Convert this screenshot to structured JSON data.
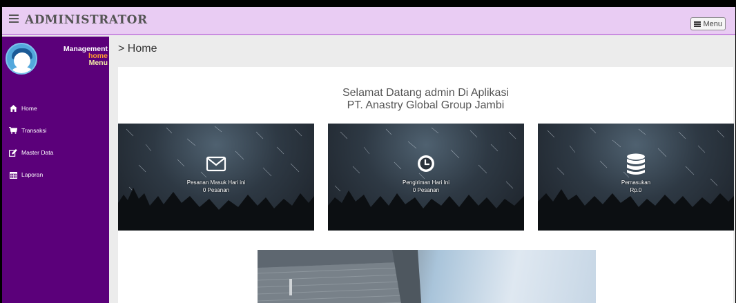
{
  "header": {
    "title": "ADMINISTRATOR",
    "menu_label": "Menu"
  },
  "sidebar": {
    "user": {
      "line1": "Management",
      "line2": "home",
      "line3": "Menu"
    },
    "items": [
      {
        "label": "Home",
        "icon": "home-icon"
      },
      {
        "label": "Transaksi",
        "icon": "cart-icon"
      },
      {
        "label": "Master Data",
        "icon": "edit-icon"
      },
      {
        "label": "Laporan",
        "icon": "calendar-icon"
      }
    ]
  },
  "breadcrumb": "> Home",
  "welcome": {
    "line1": "Selamat Datang admin Di Aplikasi",
    "line2": "PT. Anastry Global Group Jambi"
  },
  "cards": [
    {
      "title": "Pesanan Masuk Hari ini",
      "value": "0 Pesanan",
      "icon": "envelope-icon"
    },
    {
      "title": "Pengiriman Hari Ini",
      "value": "0 Pesanan",
      "icon": "clock-icon"
    },
    {
      "title": "Pemasukan",
      "value": "Rp.0",
      "icon": "database-icon"
    }
  ],
  "colors": {
    "topbar": "#e9ccf3",
    "sidebar": "#5b007a",
    "user_line2": "#ff9b2f",
    "user_line3": "#f3eaa6"
  }
}
